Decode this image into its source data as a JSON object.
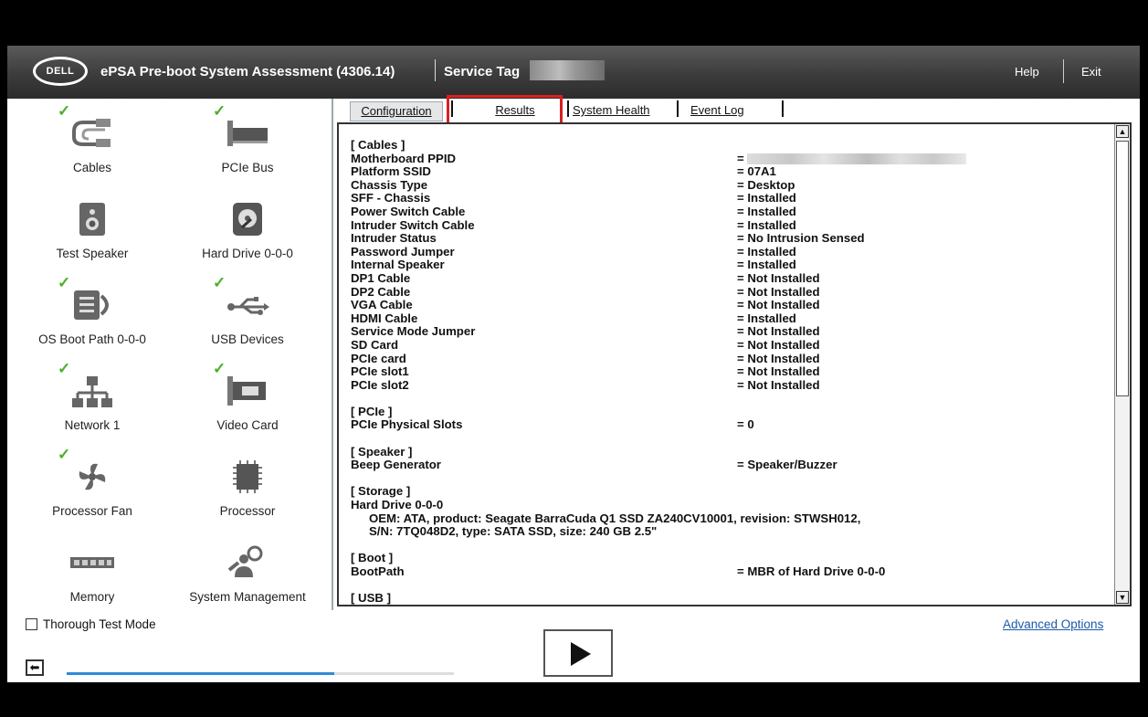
{
  "header": {
    "logo": "DELL",
    "title": "ePSA Pre-boot System Assessment (4306.14)",
    "service_tag_label": "Service Tag",
    "help": "Help",
    "exit": "Exit"
  },
  "devices": [
    {
      "label": "Cables",
      "checked": true
    },
    {
      "label": "PCIe Bus",
      "checked": true
    },
    {
      "label": "Test Speaker",
      "checked": false
    },
    {
      "label": "Hard Drive 0-0-0",
      "checked": false
    },
    {
      "label": "OS Boot Path 0-0-0",
      "checked": true
    },
    {
      "label": "USB Devices",
      "checked": true
    },
    {
      "label": "Network 1",
      "checked": true
    },
    {
      "label": "Video Card",
      "checked": true
    },
    {
      "label": "Processor Fan",
      "checked": true
    },
    {
      "label": "Processor",
      "checked": false
    },
    {
      "label": "Memory",
      "checked": false
    },
    {
      "label": "System Management",
      "checked": false
    }
  ],
  "tabs": {
    "configuration": "Configuration",
    "results": "Results",
    "system_health": "System Health",
    "event_log": "Event Log"
  },
  "config": {
    "cables_header": "[ Cables ]",
    "cables": [
      {
        "key": "Motherboard PPID",
        "value": "="
      },
      {
        "key": "Platform SSID",
        "value": "= 07A1"
      },
      {
        "key": "Chassis Type",
        "value": "= Desktop"
      },
      {
        "key": "SFF - Chassis",
        "value": "= Installed"
      },
      {
        "key": "Power Switch Cable",
        "value": "= Installed"
      },
      {
        "key": "Intruder Switch Cable",
        "value": "= Installed"
      },
      {
        "key": "Intruder Status",
        "value": "= No Intrusion Sensed"
      },
      {
        "key": "Password Jumper",
        "value": "= Installed"
      },
      {
        "key": "Internal Speaker",
        "value": "= Installed"
      },
      {
        "key": "DP1 Cable",
        "value": "= Not Installed"
      },
      {
        "key": "DP2 Cable",
        "value": "= Not Installed"
      },
      {
        "key": "VGA Cable",
        "value": "= Not Installed"
      },
      {
        "key": "HDMI Cable",
        "value": "= Installed"
      },
      {
        "key": "Service Mode Jumper",
        "value": "= Not Installed"
      },
      {
        "key": "SD Card",
        "value": "= Not Installed"
      },
      {
        "key": "PCIe card",
        "value": "= Not Installed"
      },
      {
        "key": "PCIe slot1",
        "value": "= Not Installed"
      },
      {
        "key": "PCIe slot2",
        "value": "= Not Installed"
      }
    ],
    "pcie_header": "[ PCIe ]",
    "pcie_slots_key": "PCIe Physical Slots",
    "pcie_slots_value": "= 0",
    "speaker_header": "[ Speaker ]",
    "beep_key": "Beep Generator",
    "beep_value": "= Speaker/Buzzer",
    "storage_header": "[ Storage ]",
    "hdd_key": "Hard Drive 0-0-0",
    "hdd_line1": "OEM: ATA, product: Seagate BarraCuda Q1 SSD ZA240CV10001, revision: STWSH012,",
    "hdd_line2": "S/N: 7TQ048D2, type: SATA SSD, size: 240 GB 2.5\"",
    "boot_header": "[ Boot ]",
    "bootpath_key": "BootPath",
    "bootpath_value": "= MBR of Hard Drive 0-0-0",
    "usb_header": "[ USB ]"
  },
  "bottom": {
    "thorough_label": "Thorough Test Mode",
    "advanced_options": "Advanced Options",
    "back_glyph": "⬅",
    "progress_fraction": 0.69
  },
  "colors": {
    "check": "#4caf2a",
    "highlight": "#d92020",
    "link": "#1a5aa8",
    "progress": "#2f8ad8"
  }
}
